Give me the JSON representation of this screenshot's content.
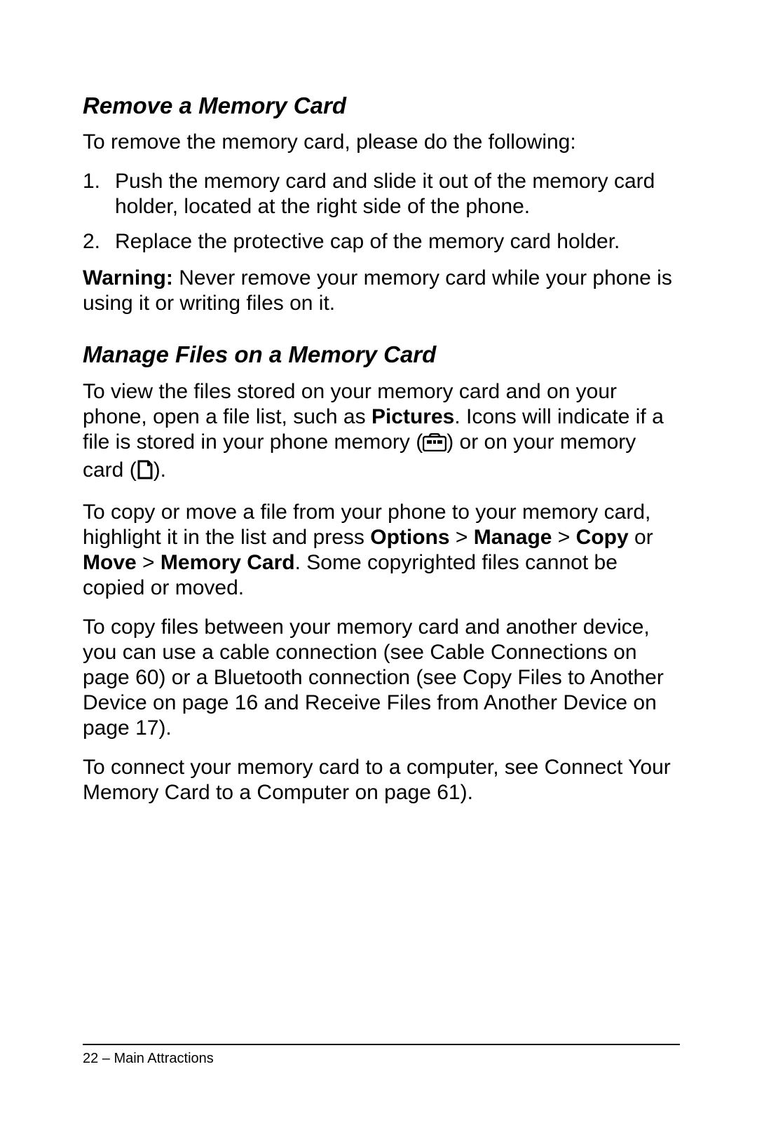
{
  "sections": {
    "remove": {
      "heading": "Remove a Memory Card",
      "intro": "To remove the memory card, please do the following:",
      "steps": {
        "n1": "1.",
        "t1": "Push the memory card and slide it out of the memory card holder, located at the right side of the phone.",
        "n2": "2.",
        "t2": "Replace the protective cap of the memory card holder."
      },
      "warning_label": "Warning:",
      "warning_text": " Never remove your memory card while your phone is using it or writing files on it."
    },
    "manage": {
      "heading": "Manage Files on a Memory Card",
      "p1a": "To view the files stored on your memory card and on your phone, open a file list, such as ",
      "p1_bold1": "Pictures",
      "p1b": ". Icons will indicate if a file is stored in your phone memory (",
      "p1c": ") or on your memory card (",
      "p1d": ").",
      "p2a": "To copy or move a file from your phone to your memory card, highlight it in the list and press ",
      "p2_opt": "Options",
      "p2_gt1": " > ",
      "p2_manage": "Manage",
      "p2_gt2": " > ",
      "p2_copy": "Copy",
      "p2_or": " or ",
      "p2_move": "Move",
      "p2_gt3": " > ",
      "p2_mc": "Memory Card",
      "p2_tail": ". Some copyrighted files cannot be copied or moved.",
      "p3": "To copy files between your memory card and another device, you can use a cable connection (see Cable Connections on page 60) or a Bluetooth connection (see Copy Files to Another Device on page 16 and Receive Files from Another Device on page 17).",
      "p4": "To connect your memory card to a computer, see Connect Your Memory Card to a Computer on page 61)."
    }
  },
  "footer": "22 – Main Attractions"
}
